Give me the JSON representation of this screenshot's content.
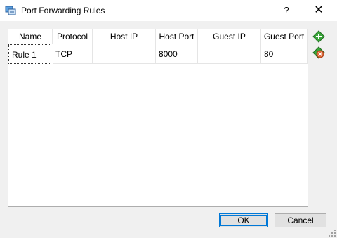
{
  "window": {
    "title": "Port Forwarding Rules",
    "app_icon": "port-forwarding-icon",
    "help_label": "?",
    "close_label": "✕"
  },
  "table": {
    "columns": [
      "Name",
      "Protocol",
      "Host IP",
      "Host Port",
      "Guest IP",
      "Guest Port"
    ],
    "rows": [
      [
        "Rule 1",
        "TCP",
        "",
        "8000",
        "",
        "80"
      ]
    ]
  },
  "side_actions": {
    "add_icon": "add-rule-icon",
    "remove_icon": "remove-rule-icon"
  },
  "buttons": {
    "ok": "OK",
    "cancel": "Cancel"
  },
  "colors": {
    "background": "#f0f0f0",
    "accent": "#0078d7",
    "add_green": "#3aa53a",
    "remove_orange": "#e06b3a"
  }
}
